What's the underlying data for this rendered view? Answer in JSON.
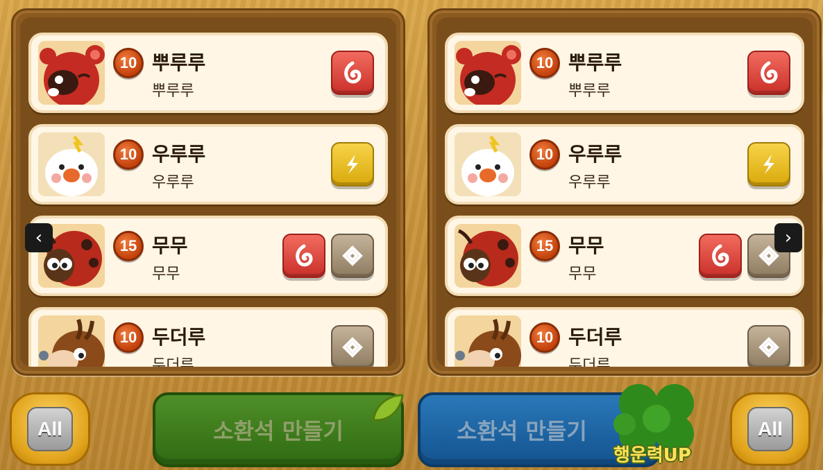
{
  "panels": [
    {
      "side": "left",
      "cards": [
        {
          "level": "10",
          "name": "뿌루루",
          "subname": "뿌루루",
          "portrait": "red-raccoon",
          "stones": [
            "fire"
          ]
        },
        {
          "level": "10",
          "name": "우루루",
          "subname": "우루루",
          "portrait": "white-chicken",
          "stones": [
            "thunder"
          ]
        },
        {
          "level": "15",
          "name": "무무",
          "subname": "무무",
          "portrait": "ladybug-cow",
          "stones": [
            "fire",
            "earth"
          ]
        },
        {
          "level": "10",
          "name": "두더루",
          "subname": "두더루",
          "portrait": "mole",
          "stones": [
            "earth"
          ]
        }
      ]
    },
    {
      "side": "right",
      "cards": [
        {
          "level": "10",
          "name": "뿌루루",
          "subname": "뿌루루",
          "portrait": "red-raccoon",
          "stones": [
            "fire"
          ]
        },
        {
          "level": "10",
          "name": "우루루",
          "subname": "우루루",
          "portrait": "white-chicken",
          "stones": [
            "thunder"
          ]
        },
        {
          "level": "15",
          "name": "무무",
          "subname": "무무",
          "portrait": "ladybug-cow",
          "stones": [
            "fire",
            "earth"
          ]
        },
        {
          "level": "10",
          "name": "두더루",
          "subname": "두더루",
          "portrait": "mole",
          "stones": [
            "earth"
          ]
        }
      ]
    }
  ],
  "nav": {
    "prev": "‹",
    "next": "›"
  },
  "bottom": {
    "all_left": "All",
    "all_right": "All",
    "summon_left": "소환석 만들기",
    "summon_right": "소환석 만들기",
    "luck_label": "행운력UP"
  },
  "colors": {
    "fire": "#d9362e",
    "thunder": "#f2c21a",
    "earth": "#a8977c",
    "level_badge": "#d2561b"
  }
}
